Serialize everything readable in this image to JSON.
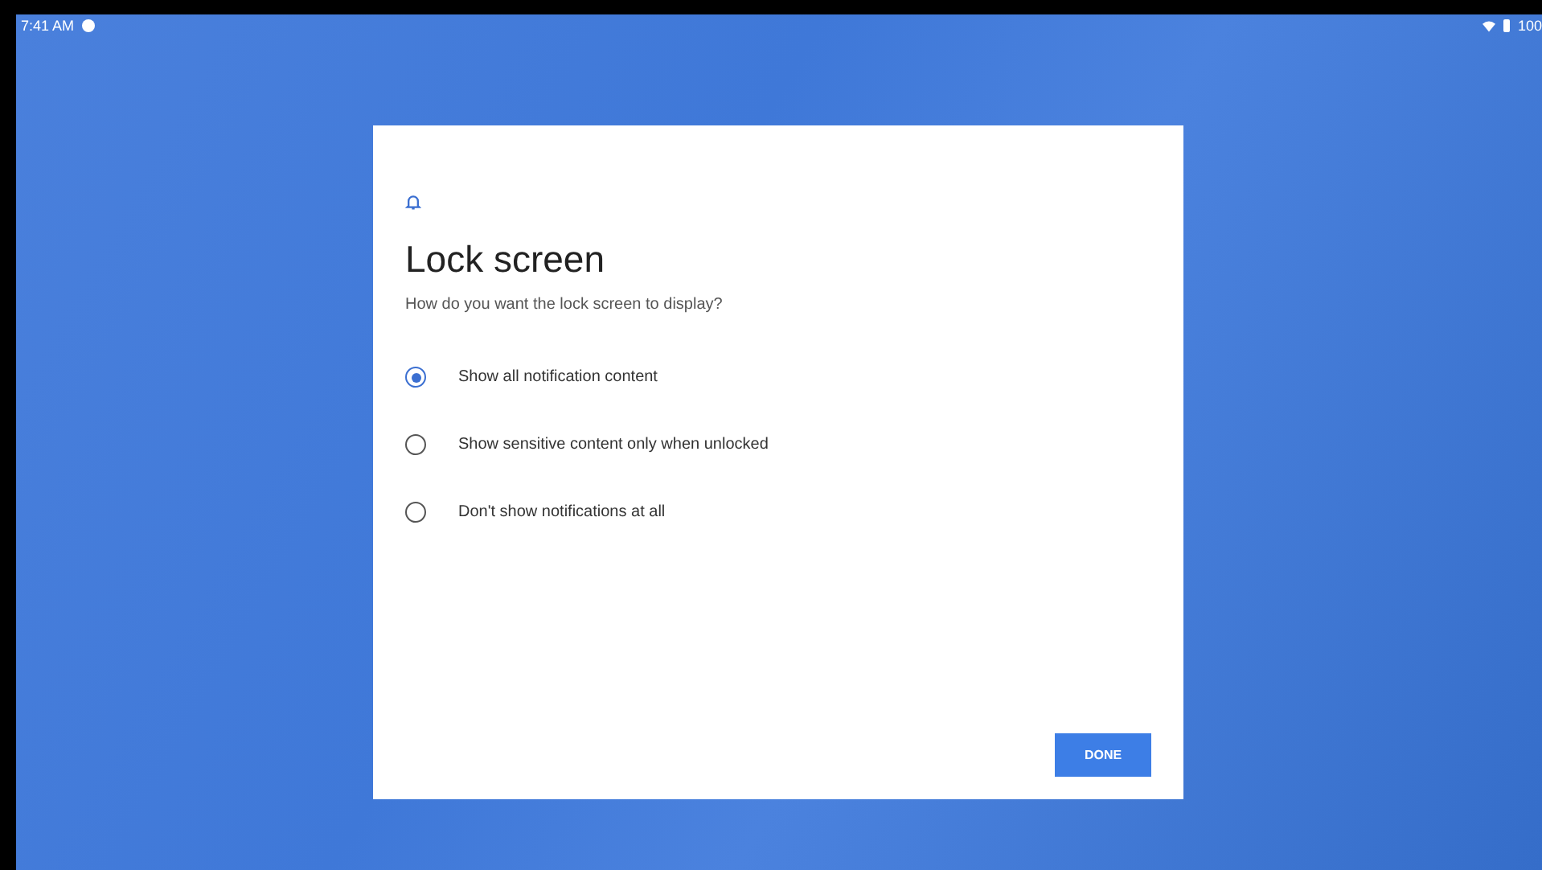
{
  "status_bar": {
    "time": "7:41 AM",
    "battery": "100"
  },
  "dialog": {
    "title": "Lock screen",
    "subtitle": "How do you want the lock screen to display?",
    "options": [
      {
        "label": "Show all notification content",
        "selected": true
      },
      {
        "label": "Show sensitive content only when unlocked",
        "selected": false
      },
      {
        "label": "Don't show notifications at all",
        "selected": false
      }
    ],
    "button": "DONE"
  }
}
